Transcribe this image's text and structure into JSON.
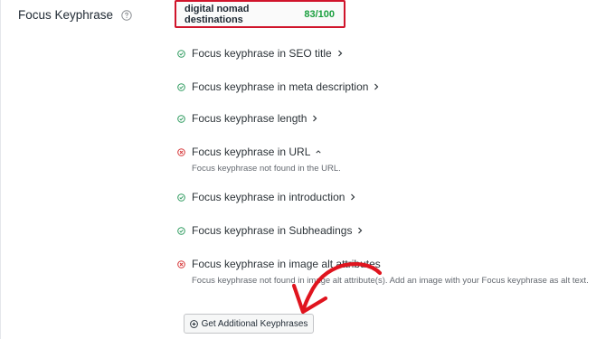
{
  "field": {
    "label": "Focus Keyphrase",
    "help_icon": "question-circle-icon"
  },
  "keyphrase": {
    "text": "digital nomad destinations",
    "score": "83/100",
    "highlight_color": "#d0142b",
    "score_color": "#1a9f3e"
  },
  "checks": [
    {
      "label": "Focus keyphrase in SEO title",
      "status": "pass",
      "chevron": "right"
    },
    {
      "label": "Focus keyphrase in meta description",
      "status": "pass",
      "chevron": "right"
    },
    {
      "label": "Focus keyphrase length",
      "status": "pass",
      "chevron": "right"
    },
    {
      "label": "Focus keyphrase in URL",
      "status": "fail",
      "chevron": "up",
      "description": "Focus keyphrase not found in the URL."
    },
    {
      "label": "Focus keyphrase in introduction",
      "status": "pass",
      "chevron": "right"
    },
    {
      "label": "Focus keyphrase in Subheadings",
      "status": "pass",
      "chevron": "right"
    },
    {
      "label": "Focus keyphrase in image alt attributes",
      "status": "fail",
      "chevron": "none",
      "description": "Focus keyphrase not found in image alt attribute(s). Add an image with your Focus keyphrase as alt text."
    }
  ],
  "status_colors": {
    "pass": "#2e9b5f",
    "fail": "#d63638"
  },
  "button": {
    "label": "Get Additional Keyphrases",
    "icon": "plus-circle-icon"
  },
  "annotation": {
    "type": "hand-drawn-arrow",
    "color": "#e0141e"
  }
}
